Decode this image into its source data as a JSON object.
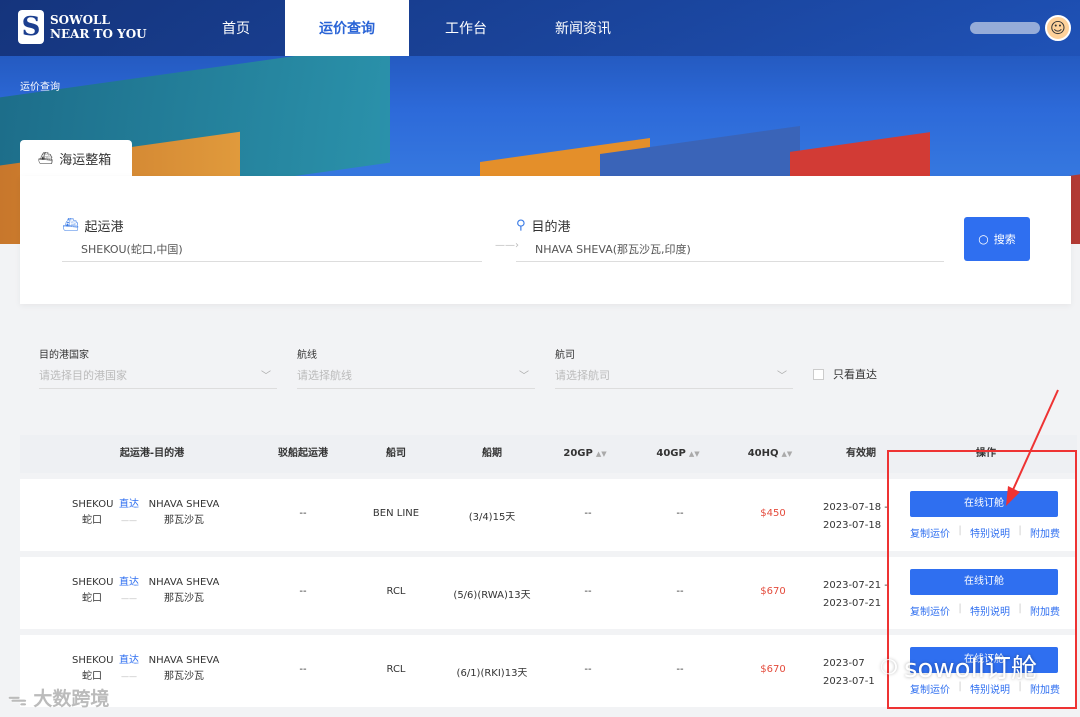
{
  "logo": {
    "mark": "S",
    "line1": "SOWOLL",
    "line2": "NEAR TO YOU"
  },
  "nav": [
    {
      "label": "首页"
    },
    {
      "label": "运价查询"
    },
    {
      "label": "工作台"
    },
    {
      "label": "新闻资讯"
    }
  ],
  "breadcrumb": "运价查询",
  "mode_tab": {
    "label": "海运整箱",
    "icon": "ship-icon"
  },
  "search": {
    "origin_label": "起运港",
    "origin_value": "SHEKOU(蛇口,中国)",
    "dest_label": "目的港",
    "dest_value": "NHAVA SHEVA(那瓦沙瓦,印度)",
    "button_label": "搜索"
  },
  "filters": [
    {
      "label": "目的港国家",
      "placeholder": "请选择目的港国家"
    },
    {
      "label": "航线",
      "placeholder": "请选择航线"
    },
    {
      "label": "航司",
      "placeholder": "请选择航司"
    }
  ],
  "direct_only_label": "只看直达",
  "table": {
    "headers": [
      "起运港-目的港",
      "驳船起运港",
      "船司",
      "船期",
      "20GP",
      "40GP",
      "40HQ",
      "有效期",
      "操作"
    ],
    "rows": [
      {
        "origin_en": "SHEKOU",
        "origin_cn": "蛇口",
        "mode": "直达",
        "dest_en": "NHAVA SHEVA",
        "dest_cn": "那瓦沙瓦",
        "barge": "--",
        "carrier": "BEN LINE",
        "schedule": "(3/4)15天",
        "gp20": "--",
        "gp40": "--",
        "hq40": "$450",
        "valid_from": "2023-07-18 -",
        "valid_to": "2023-07-18",
        "book": "在线订舱",
        "act1": "复制运价",
        "act2": "特别说明",
        "act3": "附加费"
      },
      {
        "origin_en": "SHEKOU",
        "origin_cn": "蛇口",
        "mode": "直达",
        "dest_en": "NHAVA SHEVA",
        "dest_cn": "那瓦沙瓦",
        "barge": "--",
        "carrier": "RCL",
        "schedule": "(5/6)(RWA)13天",
        "gp20": "--",
        "gp40": "--",
        "hq40": "$670",
        "valid_from": "2023-07-21 -",
        "valid_to": "2023-07-21",
        "book": "在线订舱",
        "act1": "复制运价",
        "act2": "特别说明",
        "act3": "附加费"
      },
      {
        "origin_en": "SHEKOU",
        "origin_cn": "蛇口",
        "mode": "直达",
        "dest_en": "NHAVA SHEVA",
        "dest_cn": "那瓦沙瓦",
        "barge": "--",
        "carrier": "RCL",
        "schedule": "(6/1)(RKI)13天",
        "gp20": "--",
        "gp40": "--",
        "hq40": "$670",
        "valid_from": "2023-07",
        "valid_to": "2023-07-1",
        "book": "在线订舱",
        "act1": "复制运价",
        "act2": "特别说明",
        "act3": "附加费"
      }
    ]
  },
  "watermarks": {
    "bottom_left": "大数跨境",
    "bottom_right": "sowoll订舱"
  },
  "colors": {
    "primary": "#2f6ff0",
    "price": "#e44b3c",
    "highlight": "#e33333"
  }
}
